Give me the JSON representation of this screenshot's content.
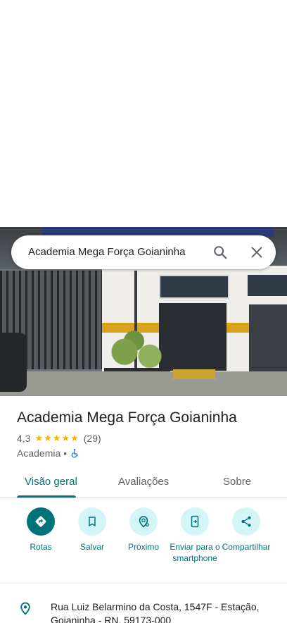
{
  "search": {
    "query": "Academia Mega Força Goianinha"
  },
  "place": {
    "title": "Academia Mega Força Goianinha",
    "rating": "4,3",
    "stars": "★★★★★",
    "reviews_count": "(29)",
    "category": "Academia",
    "separator": "•"
  },
  "tabs": [
    {
      "label": "Visão geral",
      "active": true
    },
    {
      "label": "Avaliações",
      "active": false
    },
    {
      "label": "Sobre",
      "active": false
    }
  ],
  "actions": [
    {
      "label": "Rotas",
      "icon": "directions-icon"
    },
    {
      "label": "Salvar",
      "icon": "bookmark-icon"
    },
    {
      "label": "Próximo",
      "icon": "nearby-icon"
    },
    {
      "label": "Enviar para o smartphone",
      "icon": "send-to-phone-icon"
    },
    {
      "label": "Compartilhar",
      "icon": "share-icon"
    }
  ],
  "address": "Rua Luiz Belarmino da Costa, 1547F - Estação, Goianinha - RN, 59173-000",
  "colors": {
    "accent": "#00737a",
    "accent_light": "#d4f5f8",
    "star": "#f4b400"
  }
}
